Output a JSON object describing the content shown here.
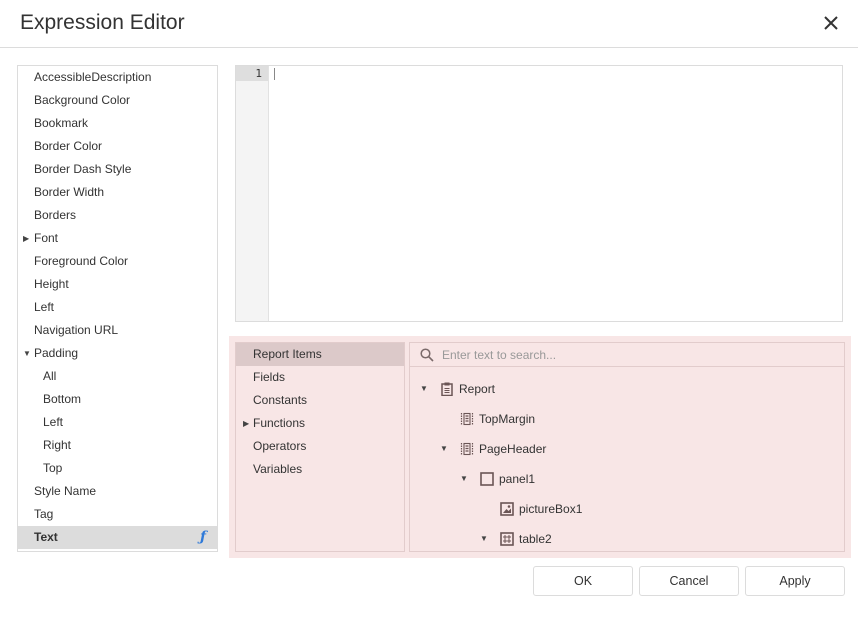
{
  "dialog": {
    "title": "Expression Editor"
  },
  "properties": [
    {
      "label": "AccessibleDescription",
      "level": 0
    },
    {
      "label": "Background Color",
      "level": 0
    },
    {
      "label": "Bookmark",
      "level": 0
    },
    {
      "label": "Border Color",
      "level": 0
    },
    {
      "label": "Border Dash Style",
      "level": 0
    },
    {
      "label": "Border Width",
      "level": 0
    },
    {
      "label": "Borders",
      "level": 0
    },
    {
      "label": "Font",
      "level": 0,
      "caret": "collapsed"
    },
    {
      "label": "Foreground Color",
      "level": 0
    },
    {
      "label": "Height",
      "level": 0
    },
    {
      "label": "Left",
      "level": 0
    },
    {
      "label": "Navigation URL",
      "level": 0
    },
    {
      "label": "Padding",
      "level": 0,
      "caret": "expanded"
    },
    {
      "label": "All",
      "level": 1
    },
    {
      "label": "Bottom",
      "level": 1
    },
    {
      "label": "Left",
      "level": 1
    },
    {
      "label": "Right",
      "level": 1
    },
    {
      "label": "Top",
      "level": 1
    },
    {
      "label": "Style Name",
      "level": 0
    },
    {
      "label": "Tag",
      "level": 0
    },
    {
      "label": "Text",
      "level": 0,
      "selected": true,
      "has_expression": true
    }
  ],
  "editor": {
    "line_numbers": [
      "1"
    ],
    "content": ""
  },
  "categories": [
    {
      "label": "Report Items",
      "selected": true
    },
    {
      "label": "Fields"
    },
    {
      "label": "Constants"
    },
    {
      "label": "Functions",
      "caret": "collapsed"
    },
    {
      "label": "Operators"
    },
    {
      "label": "Variables"
    }
  ],
  "search": {
    "placeholder": "Enter text to search...",
    "value": ""
  },
  "tree": [
    {
      "label": "Report",
      "depth": 0,
      "caret": "expanded",
      "icon": "report-icon"
    },
    {
      "label": "TopMargin",
      "depth": 1,
      "icon": "band-icon"
    },
    {
      "label": "PageHeader",
      "depth": 1,
      "caret": "expanded",
      "icon": "band-icon"
    },
    {
      "label": "panel1",
      "depth": 2,
      "caret": "expanded",
      "icon": "panel-icon"
    },
    {
      "label": "pictureBox1",
      "depth": 3,
      "icon": "picture-icon"
    },
    {
      "label": "table2",
      "depth": 3,
      "caret": "expanded",
      "icon": "table-icon"
    }
  ],
  "buttons": {
    "ok": "OK",
    "cancel": "Cancel",
    "apply": "Apply"
  },
  "colors": {
    "accent_fx": "#2f7ad9",
    "highlight_bg": "#f8e6e6",
    "selected_bg": "#dcdcdc"
  },
  "glyphs": {
    "caret_expanded": "▼",
    "caret_collapsed": "▶",
    "fx": "ƒ"
  }
}
